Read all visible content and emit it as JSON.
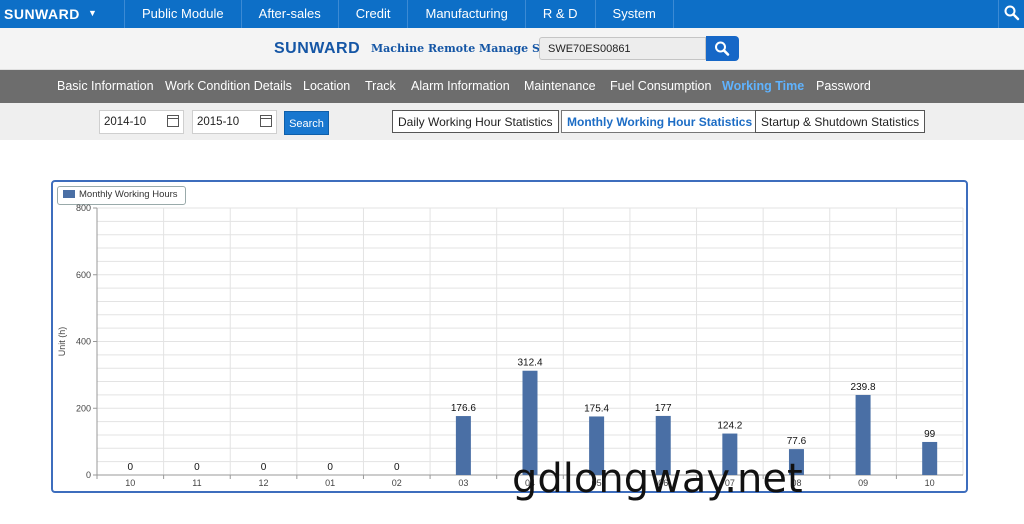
{
  "topbar": {
    "brand": "SUNWARD",
    "nav": [
      "Public Module",
      "After-sales",
      "Credit",
      "Manufacturing",
      "R & D",
      "System"
    ]
  },
  "header": {
    "logo": "SUNWARD",
    "system_title": "Machine Remote Manage System",
    "search_value": "SWE70ES00861"
  },
  "subnav": {
    "items": [
      "Basic Information",
      "Work Condition Details",
      "Location",
      "Track",
      "Alarm Information",
      "Maintenance",
      "Fuel Consumption",
      "Working Time",
      "Password"
    ],
    "active": "Working Time"
  },
  "filter": {
    "start_date": "2014-10",
    "end_date": "2015-10",
    "search_label": "Search",
    "tabs": [
      "Daily Working Hour Statistics",
      "Monthly Working Hour Statistics",
      "Startup & Shutdown Statistics"
    ],
    "active_tab": "Monthly Working Hour Statistics"
  },
  "chart_data": {
    "type": "bar",
    "legend": "Monthly Working Hours",
    "ylabel": "Unit (h)",
    "ylim": [
      0,
      800
    ],
    "yticks": [
      0,
      200,
      400,
      600,
      800
    ],
    "categories": [
      "10",
      "11",
      "12",
      "01",
      "02",
      "03",
      "04",
      "05",
      "06",
      "07",
      "08",
      "09",
      "10"
    ],
    "values": [
      0,
      0,
      0,
      0,
      0,
      176.6,
      312.4,
      175.4,
      177,
      124.2,
      77.6,
      239.8,
      99
    ],
    "labels": [
      "0",
      "0",
      "0",
      "0",
      "0",
      "176.6",
      "312.4",
      "175.4",
      "177",
      "124.2",
      "77.6",
      "239.8",
      "99"
    ],
    "grid": true,
    "bar_color": "#4a6fa5"
  },
  "watermark": "gdlongway.net"
}
